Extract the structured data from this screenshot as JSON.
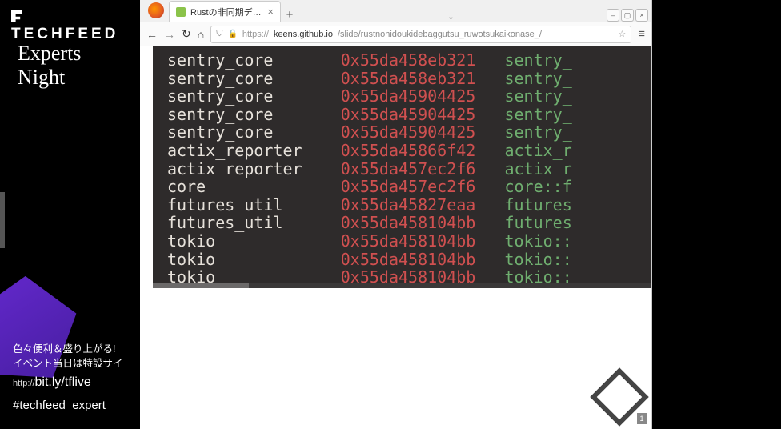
{
  "overlay": {
    "logo_text": "TECHFEED",
    "logo_sub": "Experts Night",
    "promo_line1": "色々便利＆盛り上がる!",
    "promo_line2": "イベント当日は特設サイ",
    "url_prefix": "http://",
    "url_main": "bit.ly/tflive",
    "hashtag": "#techfeed_expert"
  },
  "browser": {
    "tab_title": "Rustの非同期デバッ",
    "tab_close": "×",
    "new_tab": "+",
    "win_min": "–",
    "win_max": "▢",
    "win_close": "×",
    "tabs_caret": "⌄",
    "nav_back": "←",
    "nav_fwd": "→",
    "nav_reload": "↻",
    "nav_home": "⌂",
    "url_scheme": "https://",
    "url_host": "keens.github.io",
    "url_path": "/slide/rustnohidoukidebaggutsu_ruwotsukaikonase_/",
    "url_shield": "⛉",
    "url_lock": "🔒",
    "url_star": "☆",
    "menu": "≡"
  },
  "terminal_rows": [
    {
      "name": "sentry_core",
      "addr": "0x55da458eb321",
      "fn": "sentry_"
    },
    {
      "name": "sentry_core",
      "addr": "0x55da458eb321",
      "fn": "sentry_"
    },
    {
      "name": "sentry_core",
      "addr": "0x55da45904425",
      "fn": "sentry_"
    },
    {
      "name": "sentry_core",
      "addr": "0x55da45904425",
      "fn": "sentry_"
    },
    {
      "name": "sentry_core",
      "addr": "0x55da45904425",
      "fn": "sentry_"
    },
    {
      "name": "actix_reporter",
      "addr": "0x55da45866f42",
      "fn": "actix_r"
    },
    {
      "name": "actix_reporter",
      "addr": "0x55da457ec2f6",
      "fn": "actix_r"
    },
    {
      "name": "core",
      "addr": "0x55da457ec2f6",
      "fn": "core::f"
    },
    {
      "name": "futures_util",
      "addr": "0x55da45827eaa",
      "fn": "futures"
    },
    {
      "name": "futures_util",
      "addr": "0x55da458104bb",
      "fn": "futures"
    },
    {
      "name": "tokio",
      "addr": "0x55da458104bb",
      "fn": "tokio::"
    },
    {
      "name": "tokio",
      "addr": "0x55da458104bb",
      "fn": "tokio::"
    },
    {
      "name": "tokio",
      "addr": "0x55da458104bb",
      "fn": "tokio::"
    }
  ],
  "page_number": "1"
}
